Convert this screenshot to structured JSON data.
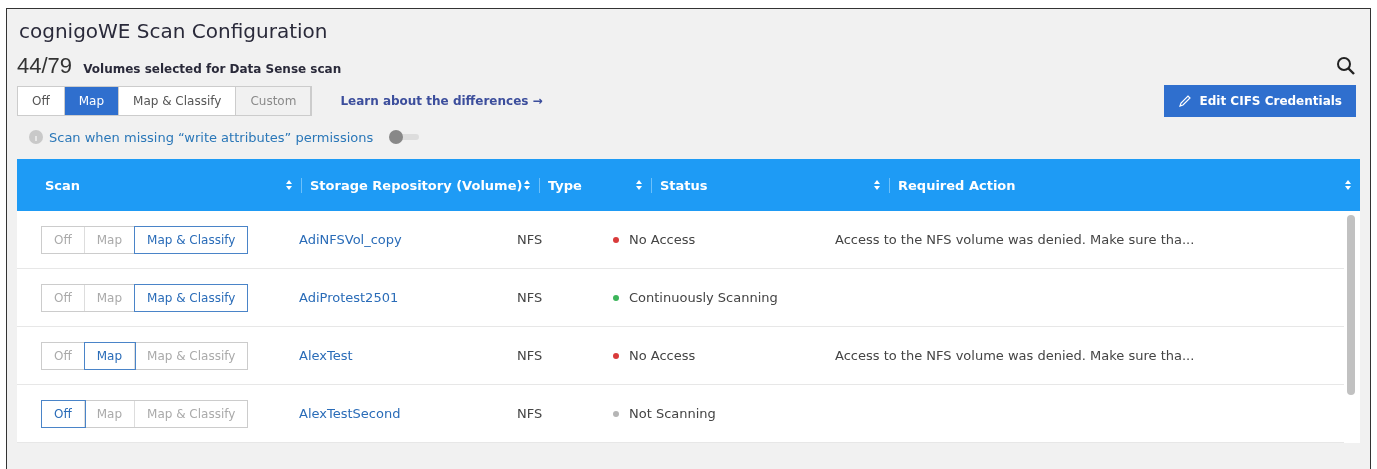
{
  "title": "cognigoWE Scan Configuration",
  "summary": {
    "count": "44/79",
    "label": "Volumes selected for Data Sense scan"
  },
  "modes": [
    {
      "label": "Off",
      "selected": false,
      "disabled": false
    },
    {
      "label": "Map",
      "selected": true,
      "disabled": false
    },
    {
      "label": "Map & Classify",
      "selected": false,
      "disabled": false
    },
    {
      "label": "Custom",
      "selected": false,
      "disabled": true
    }
  ],
  "learn_link": "Learn about the differences →",
  "edit_button": "Edit CIFS Credentials",
  "permission_toggle": {
    "label": "Scan when missing “write attributes” permissions",
    "on": false
  },
  "table": {
    "columns": [
      "Scan",
      "Storage Repository (Volume)",
      "Type",
      "Status",
      "Required Action"
    ],
    "rows": [
      {
        "scan": [
          {
            "label": "Off",
            "selected": false
          },
          {
            "label": "Map",
            "selected": false
          },
          {
            "label": "Map & Classify",
            "selected": true
          }
        ],
        "volume": "AdiNFSVol_copy",
        "type": "NFS",
        "status": "No Access",
        "color": "#d93b3b",
        "action": "Access to the NFS volume was denied. Make sure tha..."
      },
      {
        "scan": [
          {
            "label": "Off",
            "selected": false
          },
          {
            "label": "Map",
            "selected": false
          },
          {
            "label": "Map & Classify",
            "selected": true
          }
        ],
        "volume": "AdiProtest2501",
        "type": "NFS",
        "status": "Continuously Scanning",
        "color": "#3cb55a",
        "action": ""
      },
      {
        "scan": [
          {
            "label": "Off",
            "selected": false
          },
          {
            "label": "Map",
            "selected": true
          },
          {
            "label": "Map & Classify",
            "selected": false
          }
        ],
        "volume": "AlexTest",
        "type": "NFS",
        "status": "No Access",
        "color": "#d93b3b",
        "action": "Access to the NFS volume was denied. Make sure tha..."
      },
      {
        "scan": [
          {
            "label": "Off",
            "selected": true
          },
          {
            "label": "Map",
            "selected": false
          },
          {
            "label": "Map & Classify",
            "selected": false
          }
        ],
        "volume": "AlexTestSecond",
        "type": "NFS",
        "status": "Not Scanning",
        "color": "#b5b5b5",
        "action": ""
      }
    ]
  }
}
